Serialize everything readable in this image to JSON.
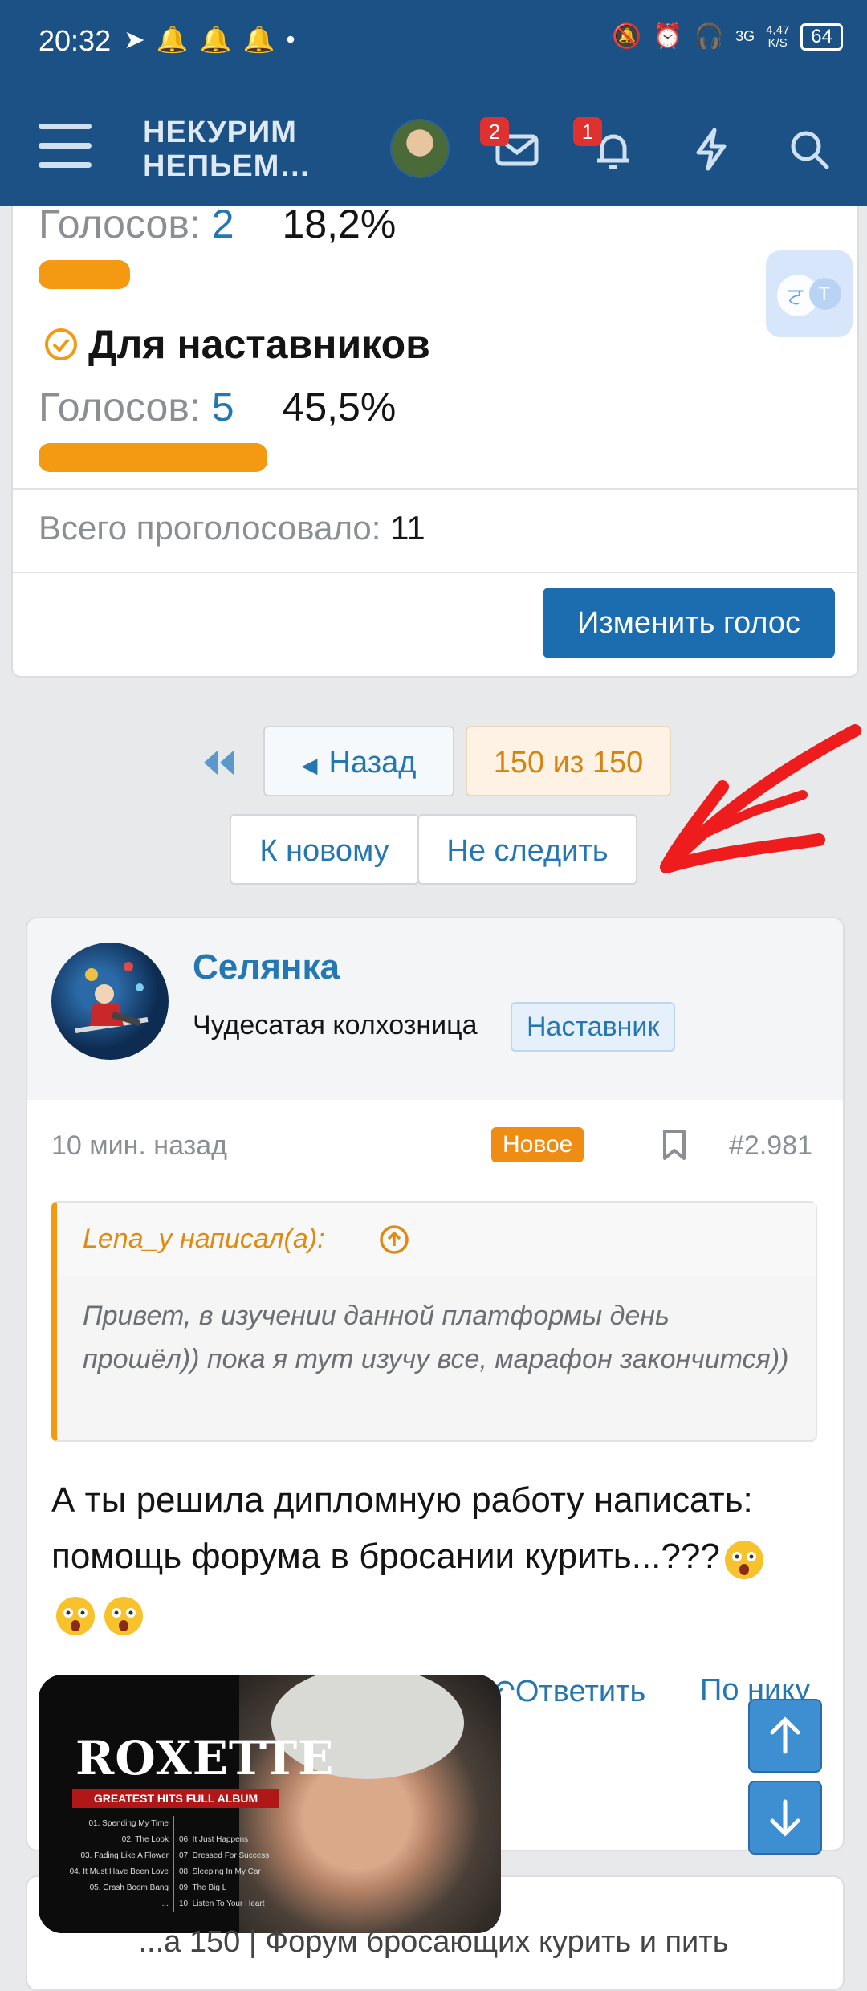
{
  "status_bar": {
    "time": "20:32",
    "network": "3G",
    "speed_value": "4,47",
    "speed_unit": "K/S",
    "battery": "64"
  },
  "app_bar": {
    "title_line1": "НЕКУРИМ",
    "title_line2": "НЕПЬЕМ…",
    "messages_badge": "2",
    "alerts_badge": "1"
  },
  "poll": {
    "options": [
      {
        "votes_label": "Голосов:",
        "votes": "2",
        "percent": "18,2%",
        "fraction": 0.182
      },
      {
        "label": "Для наставников",
        "selected": true,
        "votes_label": "Голосов:",
        "votes": "5",
        "percent": "45,5%",
        "fraction": 0.455
      }
    ],
    "total_label": "Всего проголосовало:",
    "total": "11",
    "change_vote": "Изменить голос"
  },
  "pagination": {
    "back": "Назад",
    "current": "150 из 150",
    "to_new": "К новому",
    "unwatch": "Не следить"
  },
  "post": {
    "author": "Селянка",
    "user_title": "Чудесатая колхозница",
    "role": "Наставник",
    "time": "10 мин. назад",
    "new_badge": "Новое",
    "number": "#2.981",
    "quote_author": "Lena_y написал(а):",
    "quote_text": "Привет, в изучении данной платформы день прошёл)) пока я тут изучу все, марафон закончится))",
    "body_text": "А ты решила дипломную работу написать: помощь форума в бросании курить...???",
    "reply": "Ответить",
    "by_nick": "По нику"
  },
  "media": {
    "artist": "ROXETTE",
    "album": "GREATEST HITS FULL ALBUM",
    "tracks_left": [
      "01. Spending My Time",
      "02. The Look",
      "03. Fading Like A Flower",
      "04. It Must Have Been Love",
      "05. Crash Boom Bang",
      "..."
    ],
    "tracks_right": [
      "",
      "06. It Just Happens",
      "07. Dressed For Success",
      "08. Sleeping In My Car",
      "09. The Big L",
      "10. Listen To Your Heart"
    ]
  },
  "footer": {
    "title": "...а 150 | Форум бросающих курить и пить"
  },
  "colors": {
    "header": "#1b5184",
    "accent": "#2577b1",
    "poll_bar": "#f39a12",
    "primary_button": "#1c6db0",
    "annotation": "#ee1c1c"
  }
}
